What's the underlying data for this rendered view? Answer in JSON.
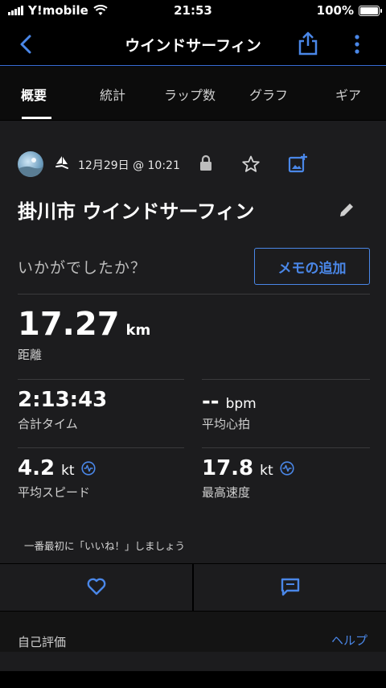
{
  "status_bar": {
    "carrier": "Y!mobile",
    "time": "21:53",
    "battery": "100%"
  },
  "nav": {
    "title": "ウインドサーフィン"
  },
  "tabs": [
    {
      "label": "概要",
      "active": true
    },
    {
      "label": "統計",
      "active": false
    },
    {
      "label": "ラップ数",
      "active": false
    },
    {
      "label": "グラフ",
      "active": false
    },
    {
      "label": "ギア",
      "active": false
    }
  ],
  "activity": {
    "date": "12月29日 @ 10:21",
    "title": "掛川市 ウインドサーフィン",
    "question": "いかがでしたか？",
    "memo_button": "メモの追加"
  },
  "stats": {
    "distance": {
      "value": "17.27",
      "unit": "km",
      "label": "距離"
    },
    "total_time": {
      "value": "2:13:43",
      "label": "合計タイム"
    },
    "avg_hr": {
      "value": "--",
      "unit": "bpm",
      "label": "平均心拍"
    },
    "avg_speed": {
      "value": "4.2",
      "unit": "kt",
      "label": "平均スピード"
    },
    "max_speed": {
      "value": "17.8",
      "unit": "kt",
      "label": "最高速度"
    }
  },
  "like_prompt": "一番最初に「いいね！」しましょう",
  "self_eval": {
    "title": "自己評価",
    "help": "ヘルプ"
  },
  "colors": {
    "accent": "#4a87e8",
    "card_bg": "#1c1c1e"
  }
}
